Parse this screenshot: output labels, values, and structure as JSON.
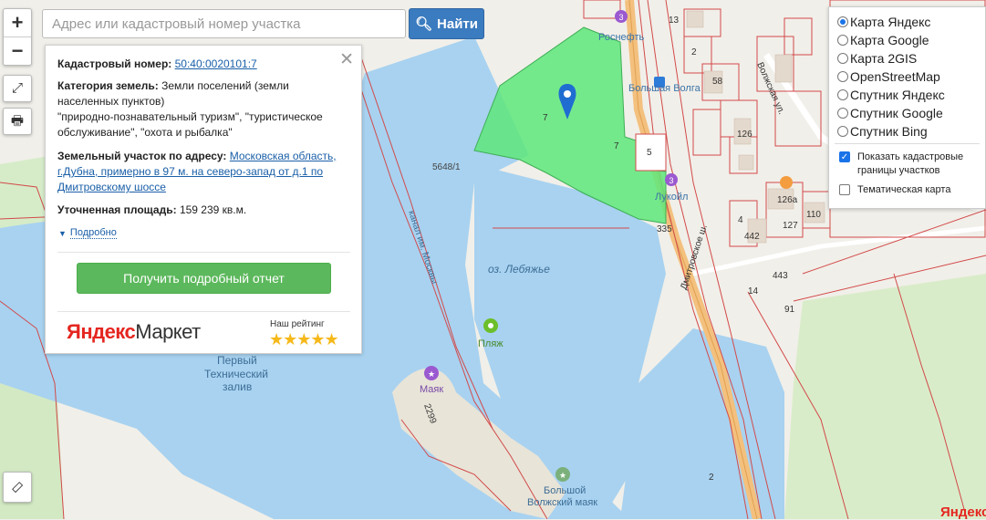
{
  "search": {
    "placeholder": "Адрес или кадастровый номер участка",
    "button_label": "Найти"
  },
  "zoom": {
    "in_label": "+",
    "out_label": "−"
  },
  "panel": {
    "cadastral_label": "Кадастровый номер:",
    "cadastral_value": "50:40:0020101:7",
    "category_label": "Категория земель:",
    "category_value": "Земли поселений (земли населенных пунктов)",
    "category_uses": "\"природно-познавательный туризм\", \"туристическое обслуживание\", \"охота и рыбалка\"",
    "address_label": "Земельный участок по адресу:",
    "address_value": "Московская область, г.Дубна, примерно в 97 м. на северо-запад от д.1 по Дмитровскому шоссе",
    "area_label": "Уточненная площадь:",
    "area_value": "159 239 кв.м.",
    "more_label": "Подробно",
    "report_button": "Получить подробный отчет",
    "ad_brand_y": "Яндекс",
    "ad_brand_rest": "Маркет",
    "rating_label": "Наш рейтинг",
    "stars": "★★★★★"
  },
  "layers": {
    "options": [
      "Карта Яндекс",
      "Карта Google",
      "Карта 2GIS",
      "OpenStreetMap",
      "Спутник Яндекс",
      "Спутник Google",
      "Спутник Bing"
    ],
    "selected_index": 0,
    "checkbox_cadastral": "Показать кадастровые границы участков",
    "checkbox_cadastral_checked": true,
    "checkbox_thematic": "Тематическая карта",
    "checkbox_thematic_checked": false
  },
  "map": {
    "labels": {
      "lake": "оз. Лебяжье",
      "canal": "канал им. Москвы",
      "bay1": "Первый",
      "bay2": "Технический",
      "bay3": "залив",
      "beach": "Пляж",
      "mayak": "Маяк",
      "bigmayak1": "Большой",
      "bigmayak2": "Волжский маяк",
      "rosneft": "Роснефть",
      "lukoil": "Лукойл",
      "bvolga": "Большая Волга",
      "road": "Дмитровское ш.",
      "volzhskaya": "Волжская ул.",
      "parcel_ref": "5648/1",
      "n7a": "7",
      "n7b": "7",
      "n5": "5",
      "n335": "335",
      "n13": "13",
      "n2a": "2",
      "n443": "443",
      "n442": "442",
      "n127": "127",
      "n110": "110",
      "n126": "126",
      "n58": "58",
      "n14": "14",
      "n91": "91",
      "n4": "4",
      "n2b": "2",
      "n2299": "2299",
      "n1263": "126а"
    },
    "brand": "Яндекс"
  }
}
